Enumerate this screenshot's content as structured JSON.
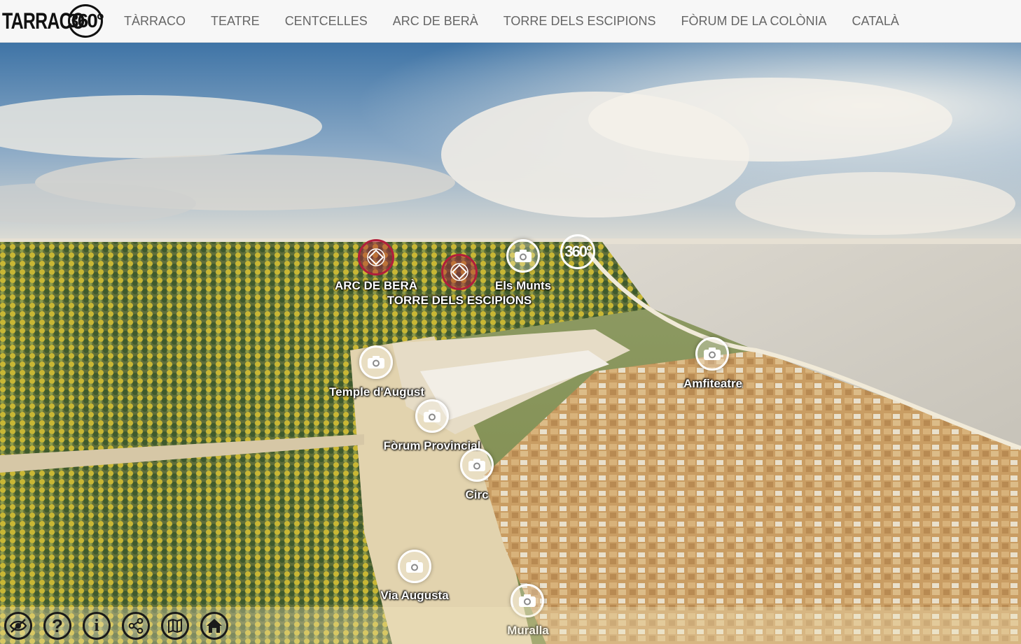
{
  "header": {
    "logo_text": "TARRACO",
    "logo_num": "360°",
    "nav": [
      "TÀRRACO",
      "TEATRE",
      "CENTCELLES",
      "ARC DE BERÀ",
      "TORRE DELS ESCIPIONS",
      "FÒRUM DE LA COLÒNIA",
      "CATALÀ"
    ]
  },
  "hotspots": {
    "arc_de_bera": "ARC DE BERÀ",
    "torre_dels_escipions": "TORRE DELS ESCIPIONS",
    "els_munts": "Els Munts",
    "view_360": "360°",
    "temple": "Temple d'August",
    "forum_provincial": "Fòrum Provincial",
    "circ": "Circ",
    "amfiteatre": "Amfiteatre",
    "via_augusta": "Via Augusta",
    "muralla": "Muralla"
  },
  "toolbar": [
    "hide-hotspots-icon",
    "help-icon",
    "info-icon",
    "share-icon",
    "map-icon",
    "home-icon"
  ],
  "colors": {
    "unesco": "#b01e3c",
    "nav_text": "#666666",
    "topbar_bg": "#f7f7f7"
  }
}
